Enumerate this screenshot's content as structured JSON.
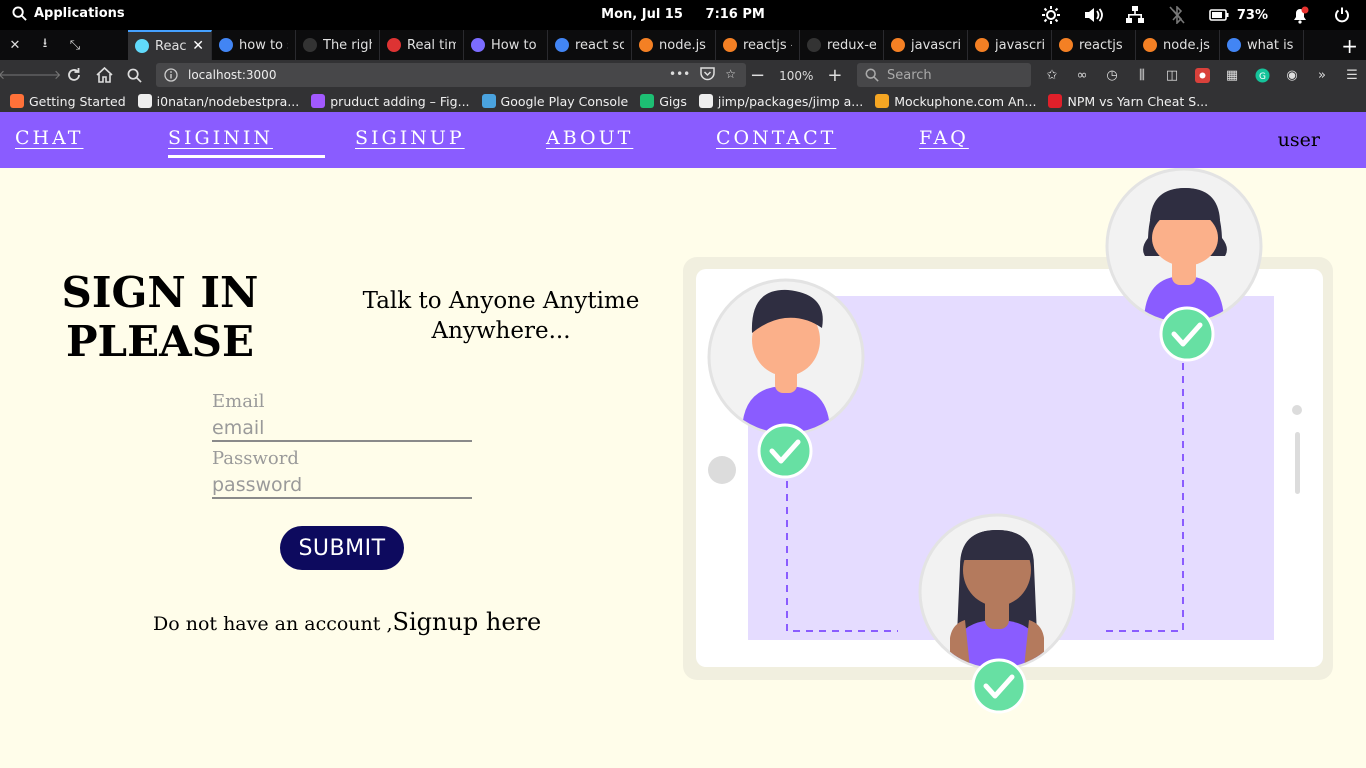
{
  "os": {
    "applications_label": "Applications",
    "clock": "Mon, Jul 15     7:16 PM",
    "battery": "73%"
  },
  "tabs": [
    {
      "label": "React",
      "favicon": "react-icon",
      "color": "#61dafb",
      "active": true
    },
    {
      "label": "how to s",
      "favicon": "google-icon",
      "color": "#4285f4"
    },
    {
      "label": "The righ",
      "favicon": "github-icon",
      "color": "#333333"
    },
    {
      "label": "Real tim",
      "favicon": "app-icon",
      "color": "#d33"
    },
    {
      "label": "How to",
      "favicon": "angular-icon",
      "color": "#7b6cff"
    },
    {
      "label": "react sc",
      "favicon": "google-icon",
      "color": "#4285f4"
    },
    {
      "label": "node.js",
      "favicon": "stackoverflow-icon",
      "color": "#f48024"
    },
    {
      "label": "reactjs -",
      "favicon": "stackoverflow-icon",
      "color": "#f48024"
    },
    {
      "label": "redux-e",
      "favicon": "github-icon",
      "color": "#333333"
    },
    {
      "label": "javascri",
      "favicon": "stackoverflow-icon",
      "color": "#f48024"
    },
    {
      "label": "javascri",
      "favicon": "stackoverflow-icon",
      "color": "#f48024"
    },
    {
      "label": "reactjs",
      "favicon": "stackoverflow-icon",
      "color": "#f48024"
    },
    {
      "label": "node.js",
      "favicon": "stackoverflow-icon",
      "color": "#f48024"
    },
    {
      "label": "what is",
      "favicon": "google-icon",
      "color": "#4285f4"
    }
  ],
  "toolbar": {
    "url": "localhost:3000",
    "zoom": "100%",
    "search_placeholder": "Search"
  },
  "bookmarks": [
    {
      "label": "Getting Started",
      "icon": "firefox-icon",
      "color": "#ff7139"
    },
    {
      "label": "i0natan/nodebestpra...",
      "icon": "github-icon",
      "color": "#eeeeee"
    },
    {
      "label": "pruduct adding – Fig...",
      "icon": "figma-icon",
      "color": "#a259ff"
    },
    {
      "label": "Google Play Console",
      "icon": "play-icon",
      "color": "#4aa3df"
    },
    {
      "label": "Gigs",
      "icon": "fiverr-icon",
      "color": "#1dbf73"
    },
    {
      "label": "jimp/packages/jimp a...",
      "icon": "github-icon",
      "color": "#eeeeee"
    },
    {
      "label": "Mockuphone.com An...",
      "icon": "mockuphone-icon",
      "color": "#f5a623"
    },
    {
      "label": "NPM vs Yarn Cheat S...",
      "icon": "cheatsheet-icon",
      "color": "#e0202a"
    }
  ],
  "nav": {
    "links": [
      "CHAT",
      "SIGININ",
      "SIGINUP",
      "ABOUT",
      "CONTACT",
      "FAQ"
    ],
    "active_index": 1,
    "user": "user"
  },
  "page": {
    "title_line1": "SIGN IN",
    "title_line2": "PLEASE",
    "tagline_line1": "Talk to Anyone Anytime",
    "tagline_line2": "Anywhere...",
    "email_label": "Email",
    "email_placeholder": "email",
    "password_label": "Password",
    "password_placeholder": "password",
    "submit": "SUBMIT",
    "signup_prefix": "Do not have an account ,",
    "signup_link": "Signup here"
  },
  "colors": {
    "nav_bg": "#8a5cff",
    "page_bg": "#fffdea",
    "button_bg": "#0d0a5e",
    "accent_purple": "#8a5cff",
    "check_green": "#67e0a3"
  }
}
